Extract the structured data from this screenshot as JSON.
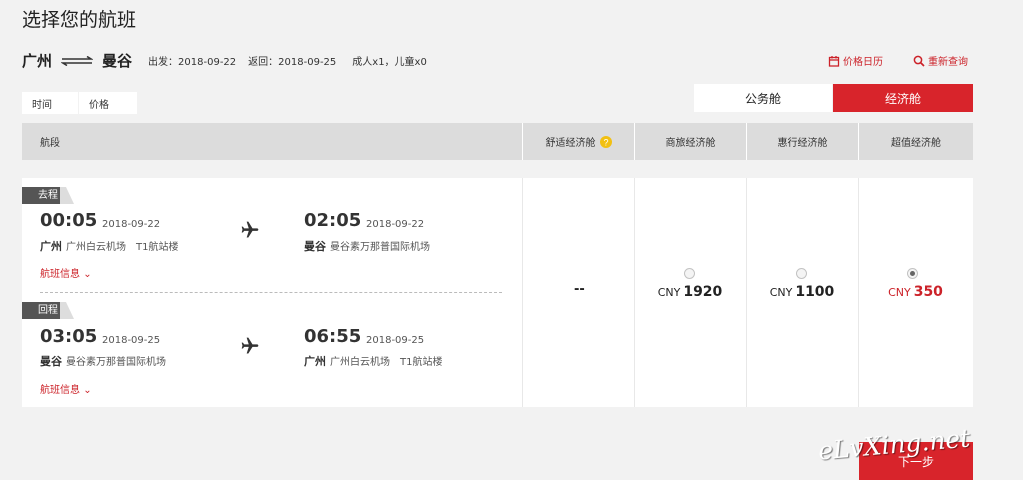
{
  "page_title": "选择您的航班",
  "route": {
    "from": "广州",
    "to": "曼谷",
    "depart": "出发：2018-09-22",
    "return": "返回：2018-09-25",
    "passengers": "成人x1，儿童x0"
  },
  "toolbar": {
    "price_calendar": "价格日历",
    "re_search": "重新查询"
  },
  "sort": {
    "time": "时间",
    "price": "价格"
  },
  "cabins": {
    "business": "公务舱",
    "economy": "经济舱",
    "selected": "经济舱"
  },
  "table": {
    "segment": "航段",
    "comfort": "舒适经济舱",
    "business_eco": "商旅经济舱",
    "hui_eco": "惠行经济舱",
    "super_eco": "超值经济舱"
  },
  "outbound": {
    "tag": "去程",
    "dep_time": "00:05",
    "dep_date": "2018-09-22",
    "dep_city": "广州",
    "dep_airport": "广州白云机场　T1航站楼",
    "arr_time": "02:05",
    "arr_date": "2018-09-22",
    "arr_city": "曼谷",
    "arr_airport": "曼谷素万那普国际机场",
    "info": "航班信息"
  },
  "return_leg": {
    "tag": "回程",
    "dep_time": "03:05",
    "dep_date": "2018-09-25",
    "dep_city": "曼谷",
    "dep_airport": "曼谷素万那普国际机场",
    "arr_time": "06:55",
    "arr_date": "2018-09-25",
    "arr_city": "广州",
    "arr_airport": "广州白云机场　T1航站楼",
    "info": "航班信息"
  },
  "fares": {
    "comfort": "--",
    "currency": "CNY",
    "business_eco": "1920",
    "hui_eco": "1100",
    "super_eco": "350",
    "selected": "super_eco"
  },
  "next_button": "下一步",
  "watermark": "eLvXing.net",
  "colors": {
    "accent": "#d8242b",
    "header_bg": "#dcdcdc",
    "tip_icon": "#f2c011"
  }
}
